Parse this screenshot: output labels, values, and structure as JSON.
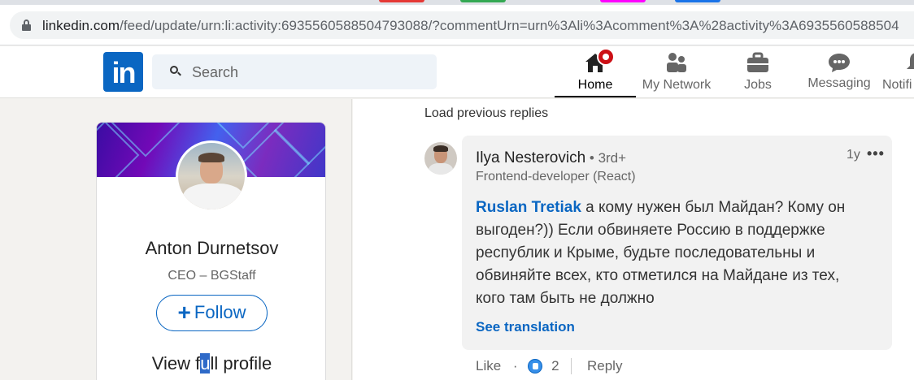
{
  "browser": {
    "url_domain": "linkedin.com",
    "url_path": "/feed/update/urn:li:activity:6935560588504793088/?commentUrn=urn%3Ali%3Acomment%3A%28activity%3A6935560588504",
    "tab_colors": [
      "#e53935",
      "#34a853",
      "#ff00ff",
      "#1a73e8"
    ]
  },
  "header": {
    "logo_text": "in",
    "search_placeholder": "Search",
    "nav": [
      {
        "label": "Home",
        "icon": "home-icon",
        "active": true
      },
      {
        "label": "My Network",
        "icon": "network-icon"
      },
      {
        "label": "Jobs",
        "icon": "briefcase-icon"
      },
      {
        "label": "Messaging",
        "icon": "messaging-icon"
      },
      {
        "label": "Notifi",
        "icon": "bell-icon"
      }
    ]
  },
  "profile": {
    "name": "Anton Durnetsov",
    "headline": "CEO – BGStaff",
    "follow_label": "Follow",
    "view_full_pre": "View f",
    "view_full_sel": "u",
    "view_full_post": "ll profile"
  },
  "comment": {
    "load_previous": "Load previous replies",
    "author": "Ilya Nesterovich",
    "degree": " • 3rd+",
    "role": "Frontend-developer (React)",
    "time": "1y",
    "more": "•••",
    "mention": "Ruslan Tretiak",
    "text": " а кому нужен был Майдан? Кому он выгоден?)) Если обвиняете Россию в поддержке республик и Крыме, будьте последовательны и обвиняйте всех, кто отметился на Майдане из тех, кого там быть не должно",
    "see_translation": "See translation",
    "like_label": "Like",
    "dot": "·",
    "like_count": "2",
    "reply_label": "Reply"
  },
  "colors": {
    "accent": "#0a66c2",
    "badge": "#cc1016"
  }
}
